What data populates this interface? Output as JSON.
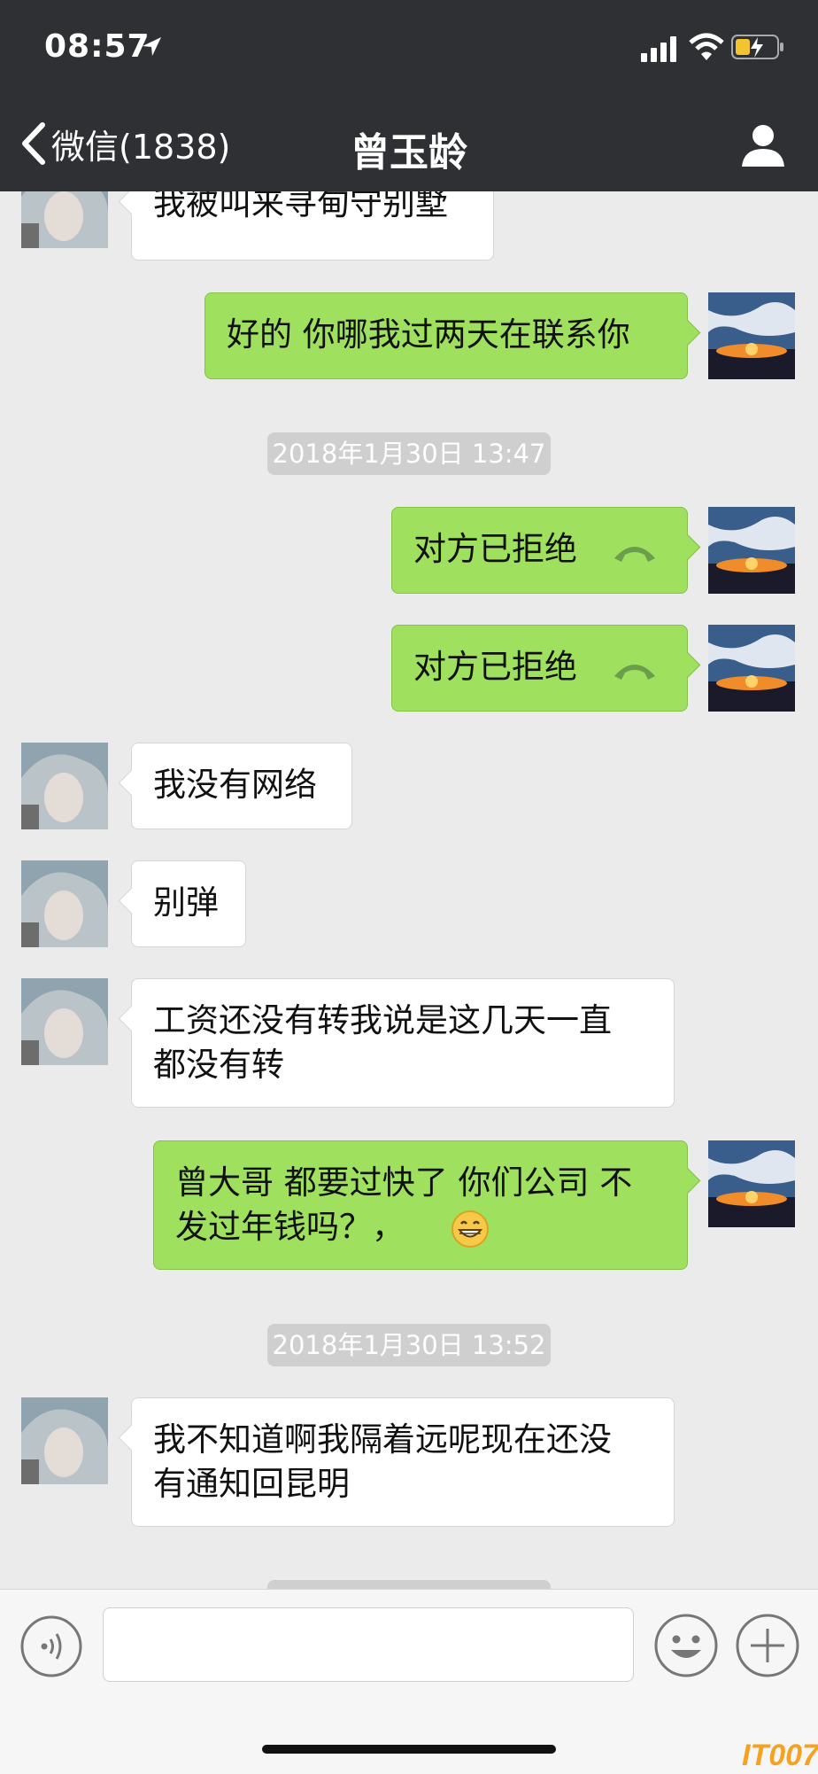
{
  "status": {
    "time": "08:57"
  },
  "nav": {
    "back_label": "微信(1838)",
    "title": "曾玉龄"
  },
  "messages": {
    "m1": "我被叫来寻甸守别墅",
    "m2": "好的 你哪我过两天在联系你",
    "ts1": "2018年1月30日 13:47",
    "m3": "对方已拒绝",
    "m4": "对方已拒绝",
    "m5": "我没有网络",
    "m6": "别弹",
    "m7_l1": "工资还没有转我说是这几天一直",
    "m7_l2": "都没有转",
    "m8_l1": "曾大哥 都要过快了 你们公司 不",
    "m8_l2": "发过年钱吗？，",
    "ts2": "2018年1月30日 13:52",
    "m9_l1": "我不知道啊我隔着远呢现在还没",
    "m9_l2": "有通知回昆明"
  },
  "input": {
    "value": ""
  },
  "watermark": "IT007",
  "colors": {
    "outgoing": "#9fe05e",
    "incoming": "#ffffff",
    "chat_bg": "#ebebeb",
    "nav_bg": "#2e3033"
  }
}
